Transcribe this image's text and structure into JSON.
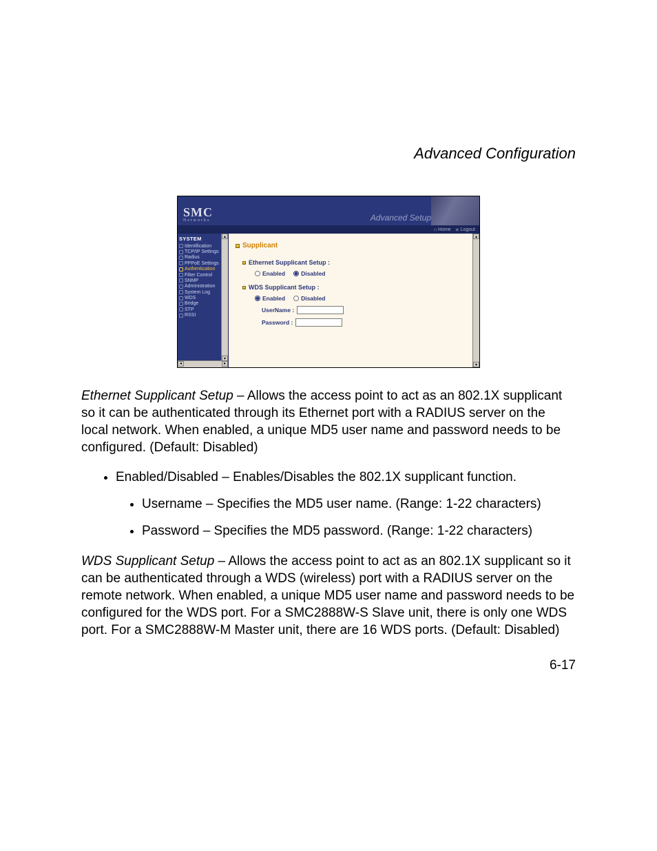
{
  "page": {
    "section_title": "Advanced Configuration",
    "page_number": "6-17"
  },
  "screenshot": {
    "logo_big": "SMC",
    "logo_small": "Networks",
    "header_label": "Advanced Setup",
    "tabs": {
      "home": "Home",
      "logout": "Logout"
    },
    "sidebar": {
      "heading": "SYSTEM",
      "items": [
        {
          "label": "Identification",
          "selected": false
        },
        {
          "label": "TCP/IP Settings",
          "selected": false
        },
        {
          "label": "Radius",
          "selected": false
        },
        {
          "label": "PPPoE Settings",
          "selected": false
        },
        {
          "label": "Authentication",
          "selected": true
        },
        {
          "label": "Filter Control",
          "selected": false
        },
        {
          "label": "SNMP",
          "selected": false
        },
        {
          "label": "Administration",
          "selected": false
        },
        {
          "label": "System Log",
          "selected": false
        },
        {
          "label": "WDS",
          "selected": false
        },
        {
          "label": "Bridge",
          "selected": false
        },
        {
          "label": "STP",
          "selected": false
        },
        {
          "label": "RSSI",
          "selected": false
        }
      ]
    },
    "content": {
      "title": "Supplicant",
      "eth": {
        "heading": "Ethernet Supplicant Setup :",
        "enabled_label": "Enabled",
        "disabled_label": "Disabled",
        "selected": "disabled"
      },
      "wds": {
        "heading": "WDS Supplicant Setup :",
        "enabled_label": "Enabled",
        "disabled_label": "Disabled",
        "selected": "enabled",
        "username_label": "UserName :",
        "username_value": "",
        "password_label": "Password :",
        "password_value": ""
      }
    }
  },
  "body": {
    "p1_em": "Ethernet Supplicant Setup",
    "p1_rest": " – Allows the access point to act as an 802.1X supplicant so it can be authenticated through its Ethernet port with a RADIUS server on the local network. When enabled, a unique MD5 user name and password needs to be configured. (Default: Disabled)",
    "li1": "Enabled/Disabled – Enables/Disables the 802.1X supplicant function.",
    "li1a": "Username – Specifies the MD5 user name. (Range: 1-22 characters)",
    "li1b": "Password – Specifies the MD5 password. (Range: 1-22 characters)",
    "p2_em": "WDS Supplicant Setup",
    "p2_rest": " – Allows the access point to act as an 802.1X supplicant so it can be authenticated through a WDS (wireless) port with a RADIUS server on the remote network. When enabled, a unique MD5 user name and password needs to be configured for the WDS port. For a SMC2888W-S Slave unit, there is only one WDS port. For a SMC2888W-M Master unit, there are 16 WDS ports. (Default: Disabled)"
  }
}
